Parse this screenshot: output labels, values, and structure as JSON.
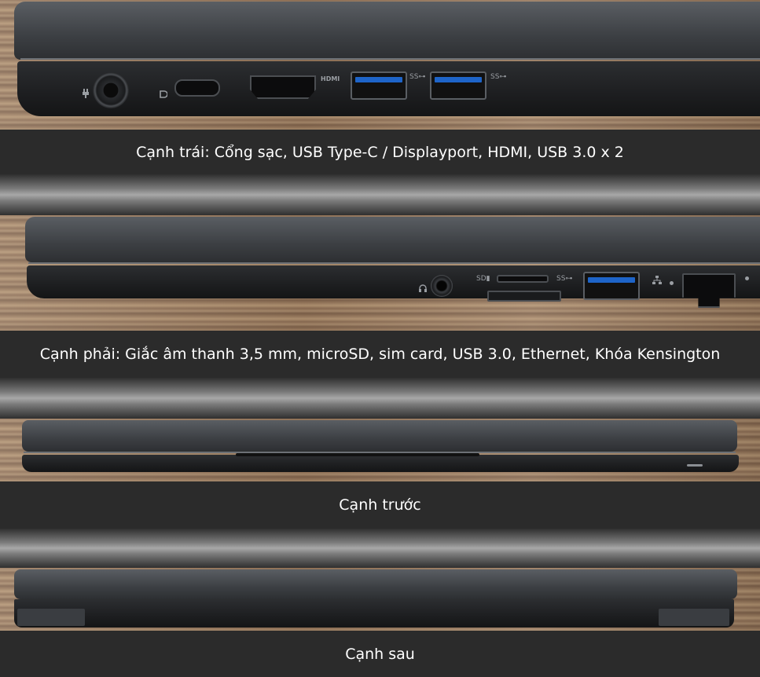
{
  "captions": {
    "left": "Cạnh trái: Cổng sạc, USB Type-C / Displayport, HDMI, USB 3.0 x 2",
    "right": "Cạnh phải: Giắc âm thanh 3,5 mm, microSD, sim card, USB 3.0, Ethernet, Khóa Kensington",
    "front": "Cạnh trước",
    "back": "Cạnh sau"
  },
  "port_labels": {
    "hdmi": "HDMI",
    "ss1": "SS⊶",
    "ss2": "SS⊶",
    "sd": "SD▮",
    "ss3": "SS⊶"
  },
  "colors": {
    "caption_bg": "#2b2b2b",
    "caption_text": "#ffffff",
    "laptop_body": "#2d2f32",
    "usb_blue": "#1e64c8"
  },
  "icons": [
    "power-icon",
    "displayport-icon",
    "headphone-icon",
    "ethernet-icon",
    "kensington-lock-icon"
  ]
}
